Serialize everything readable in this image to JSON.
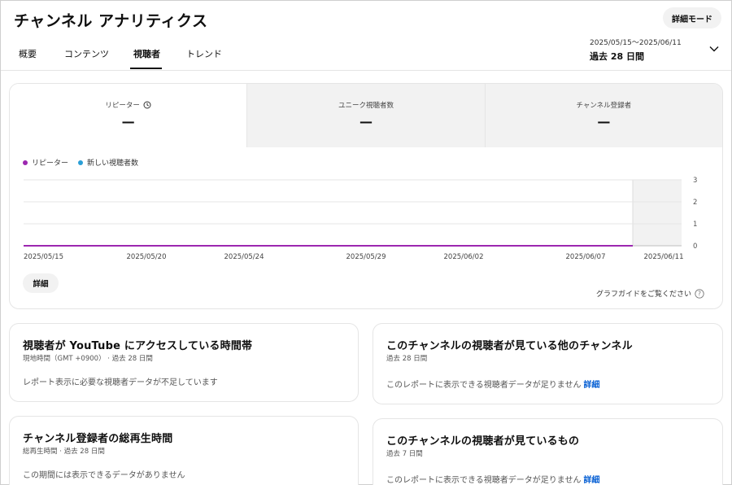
{
  "header": {
    "title": "チャンネル アナリティクス",
    "detail_mode_label": "詳細モード",
    "tabs": [
      {
        "label": "概要"
      },
      {
        "label": "コンテンツ"
      },
      {
        "label": "視聴者"
      },
      {
        "label": "トレンド"
      }
    ],
    "active_tab": "視聴者",
    "date_range": "2025/05/15～2025/06/11",
    "date_period": "過去 28 日間"
  },
  "metrics": [
    {
      "label": "リピーター",
      "value": "—",
      "has_history_icon": true
    },
    {
      "label": "ユニーク視聴者数",
      "value": "—"
    },
    {
      "label": "チャンネル登録者",
      "value": "—"
    }
  ],
  "legend": [
    {
      "label": "リピーター",
      "color": "#9c27b0"
    },
    {
      "label": "新しい視聴者数",
      "color": "#2a9fd6"
    }
  ],
  "chart_data": {
    "type": "line",
    "x_ticks": [
      "2025/05/15",
      "2025/05/20",
      "2025/05/24",
      "2025/05/29",
      "2025/06/02",
      "2025/06/07",
      "2025/06/11"
    ],
    "y_ticks": [
      3,
      2,
      1,
      0
    ],
    "ylim": [
      0,
      3
    ],
    "series": [
      {
        "name": "リピーター",
        "values": [
          0,
          0,
          0,
          0,
          0,
          0,
          0
        ]
      },
      {
        "name": "新しい視聴者数",
        "values": [
          0,
          0,
          0,
          0,
          0,
          0,
          0
        ]
      }
    ]
  },
  "chart_footer": {
    "detail_label": "詳細",
    "graph_guide_label": "グラフガイドをご覧ください"
  },
  "panels": {
    "time_on_youtube": {
      "title": "視聴者が YouTube にアクセスしている時間帯",
      "subtitle": "現地時間（GMT +0900） · 過去 28 日間",
      "message": "レポート表示に必要な視聴者データが不足しています"
    },
    "other_channels": {
      "title": "このチャンネルの視聴者が見ている他のチャンネル",
      "subtitle": "過去 28 日間",
      "message": "このレポートに表示できる視聴者データが足りません",
      "link": "詳細"
    },
    "subscriber_watch_time": {
      "title": "チャンネル登録者の総再生時間",
      "subtitle": "総再生時間 · 過去 28 日間",
      "message": "この期間には表示できるデータがありません"
    },
    "what_viewers_watch": {
      "title": "このチャンネルの視聴者が見ているもの",
      "subtitle": "過去 7 日間",
      "message": "このレポートに表示できる視聴者データが足りません",
      "link": "詳細"
    }
  }
}
